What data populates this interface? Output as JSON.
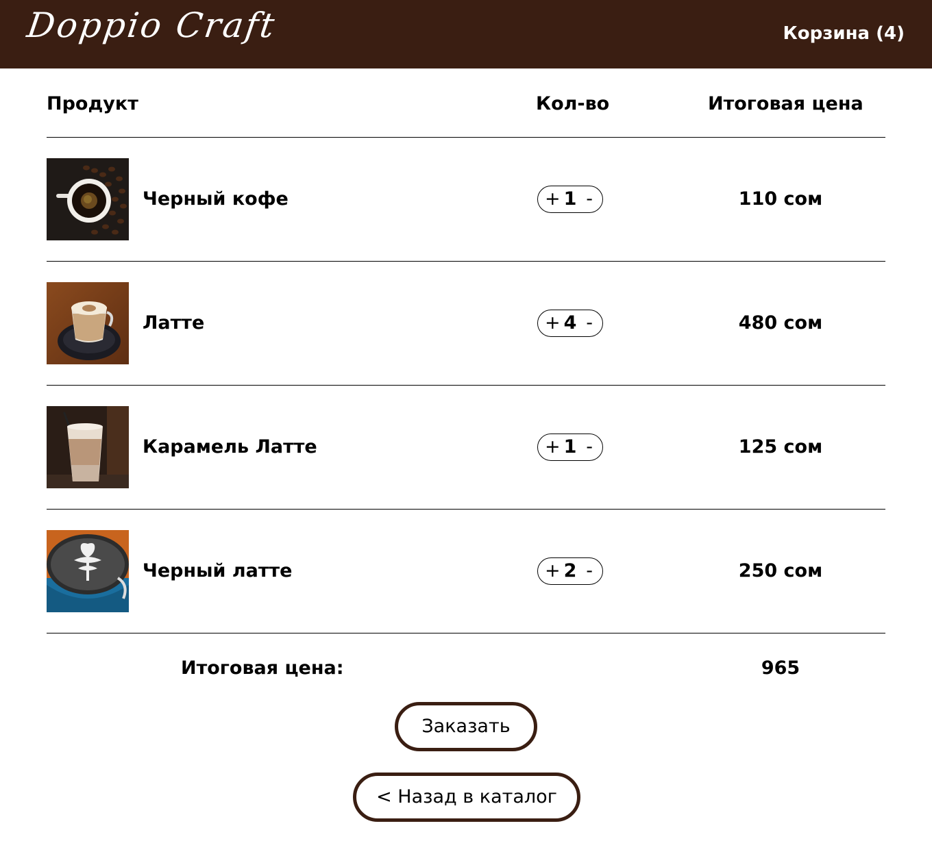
{
  "header": {
    "logo": "Doppio Craft",
    "cart_label": "Корзина (4)",
    "bg_color": "#3a1e12"
  },
  "table": {
    "col_product": "Продукт",
    "col_qty": "Кол-во",
    "col_total": "Итоговая цена"
  },
  "items": [
    {
      "name": "Черный кофе",
      "plus": "+",
      "qty": "1",
      "minus": "-",
      "price": "110 сом",
      "image_icon": "black-coffee-image"
    },
    {
      "name": "Латте",
      "plus": "+",
      "qty": "4",
      "minus": "-",
      "price": "480 сом",
      "image_icon": "latte-image"
    },
    {
      "name": "Карамель Латте",
      "plus": "+",
      "qty": "1",
      "minus": "-",
      "price": "125 сом",
      "image_icon": "caramel-latte-image"
    },
    {
      "name": "Черный латте",
      "plus": "+",
      "qty": "2",
      "minus": "-",
      "price": "250 сом",
      "image_icon": "black-latte-image"
    }
  ],
  "summary": {
    "total_label": "Итоговая цена:",
    "total_value": "965"
  },
  "actions": {
    "order_label": "Заказать",
    "back_label": "< Назад в каталог"
  }
}
